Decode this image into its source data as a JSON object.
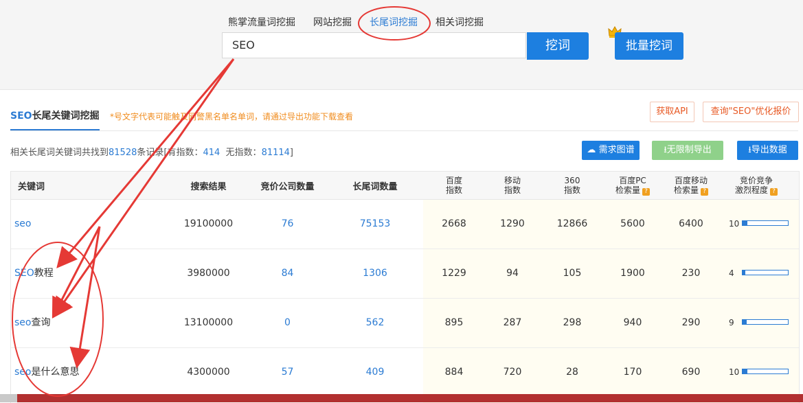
{
  "search": {
    "tabs": [
      "熊掌流量词挖掘",
      "网站挖掘",
      "长尾词挖掘",
      "相关词挖掘"
    ],
    "active_tab_index": 2,
    "query": "SEO",
    "search_label": "挖词",
    "batch_label": "批量挖词"
  },
  "panel": {
    "title_accent": "SEO",
    "title_rest": "长尾关键词挖掘",
    "note": "*号文字代表可能触及网警黑名单名单词，请通过导出功能下载查看",
    "api_label": "获取API",
    "quote_label": "查询\"SEO\"优化报价"
  },
  "summary": {
    "prefix": "相关长尾词关键词共找到",
    "total": "81528",
    "mid": "条记录[有指数：",
    "with_index": "414",
    "mid2": "无指数：",
    "without_index": "81114",
    "suffix": "]"
  },
  "actions": {
    "map_label": "需求图谱",
    "unlimited_label": "无限制导出",
    "export_label": "导出数据"
  },
  "colors": {
    "primary": "#1d7fe0",
    "green": "#8fd18a",
    "accent_orange": "#f08c1e",
    "annotation_red": "#e53935"
  },
  "table": {
    "headers": {
      "keyword": "关键词",
      "results": "搜索结果",
      "bid_companies": "竞价公司数量",
      "longtail": "长尾词数量",
      "baidu_index_1": "百度",
      "baidu_index_2": "指数",
      "mobile_index_1": "移动",
      "mobile_index_2": "指数",
      "index360_1": "360",
      "index360_2": "指数",
      "pc_search_1": "百度PC",
      "pc_search_2": "检索量",
      "mobile_search_1": "百度移动",
      "mobile_search_2": "检索量",
      "competition_1": "竞价竞争",
      "competition_2": "激烈程度"
    },
    "rows": [
      {
        "kw_blue": "seo",
        "kw_rest": "",
        "results": "19100000",
        "bid": "76",
        "longtail": "75153",
        "baidu": "2668",
        "mobile": "1290",
        "i360": "12866",
        "pc": "5600",
        "mob_search": "6400",
        "competition": "10",
        "competition_level": 0.1
      },
      {
        "kw_blue": "SEO",
        "kw_rest": "教程",
        "results": "3980000",
        "bid": "84",
        "longtail": "1306",
        "baidu": "1229",
        "mobile": "94",
        "i360": "105",
        "pc": "1900",
        "mob_search": "230",
        "competition": "4",
        "competition_level": 0.04
      },
      {
        "kw_blue": "seo",
        "kw_rest": "查询",
        "results": "13100000",
        "bid": "0",
        "longtail": "562",
        "baidu": "895",
        "mobile": "287",
        "i360": "298",
        "pc": "940",
        "mob_search": "290",
        "competition": "9",
        "competition_level": 0.09
      },
      {
        "kw_blue": "seo",
        "kw_rest": "是什么意思",
        "results": "4300000",
        "bid": "57",
        "longtail": "409",
        "baidu": "884",
        "mobile": "720",
        "i360": "28",
        "pc": "170",
        "mob_search": "690",
        "competition": "10",
        "competition_level": 0.1
      }
    ]
  }
}
